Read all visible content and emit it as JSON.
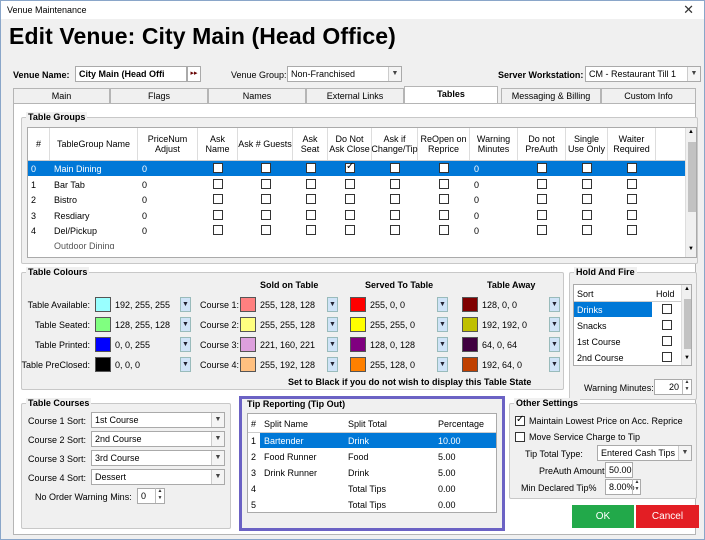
{
  "window": {
    "title": "Venue Maintenance",
    "close_glyph": "✕"
  },
  "header": {
    "title": "Edit Venue: City Main (Head Office)"
  },
  "venue_name": {
    "label": "Venue Name:",
    "value": "City Main (Head Offi",
    "picker": "▸▸"
  },
  "venue_group": {
    "label": "Venue Group:",
    "value": "Non-Franchised"
  },
  "server_workstation": {
    "label": "Server Workstation:",
    "value": "CM - Restaurant Till 1"
  },
  "tabs": [
    {
      "label": "Main"
    },
    {
      "label": "Flags"
    },
    {
      "label": "Names"
    },
    {
      "label": "External Links"
    },
    {
      "label": "Tables"
    },
    {
      "label": "Messaging & Billing"
    },
    {
      "label": "Custom Info"
    }
  ],
  "table_groups": {
    "title": "Table Groups",
    "columns": [
      "#",
      "TableGroup Name",
      "PriceNum Adjust",
      "Ask Name",
      "Ask # Guests",
      "Ask Seat",
      "Do Not Ask Close",
      "Ask if Change/Tip",
      "ReOpen on Reprice",
      "Warning Minutes",
      "Do not PreAuth",
      "Single Use Only",
      "Waiter Required"
    ],
    "rows": [
      {
        "num": "0",
        "name": "Main Dining",
        "price": "0",
        "warn": "0",
        "checks": [
          false,
          false,
          false,
          true,
          false,
          false,
          false,
          false,
          false
        ]
      },
      {
        "num": "1",
        "name": "Bar Tab",
        "price": "0",
        "warn": "0",
        "checks": [
          false,
          false,
          false,
          false,
          false,
          false,
          false,
          false,
          false
        ]
      },
      {
        "num": "2",
        "name": "Bistro",
        "price": "0",
        "warn": "0",
        "checks": [
          false,
          false,
          false,
          false,
          false,
          false,
          false,
          false,
          false
        ]
      },
      {
        "num": "3",
        "name": "Resdiary",
        "price": "0",
        "warn": "0",
        "checks": [
          false,
          false,
          false,
          false,
          false,
          false,
          false,
          false,
          false
        ]
      },
      {
        "num": "4",
        "name": "Del/Pickup",
        "price": "0",
        "warn": "0",
        "checks": [
          false,
          false,
          false,
          false,
          false,
          false,
          false,
          false,
          false
        ]
      }
    ],
    "partial_row": "Outdoor Dining"
  },
  "table_colours": {
    "title": "Table Colours",
    "states": [
      {
        "label": "Table Available:",
        "color": "#99ffff",
        "value": "192, 255, 255"
      },
      {
        "label": "Table Seated:",
        "color": "#80ff80",
        "value": "128, 255, 128"
      },
      {
        "label": "Table Printed:",
        "color": "#0000ff",
        "value": "0, 0, 255"
      },
      {
        "label": "Table PreClosed:",
        "color": "#000000",
        "value": "0, 0, 0"
      }
    ],
    "sold_title": "Sold on Table",
    "served_title": "Served To Table",
    "away_title": "Table Away",
    "courses": [
      {
        "label": "Course 1:",
        "sold": {
          "color": "#ff8080",
          "value": "255, 128, 128"
        },
        "served": {
          "color": "#ff0000",
          "value": "255, 0, 0"
        },
        "away": {
          "color": "#800000",
          "value": "128, 0, 0"
        }
      },
      {
        "label": "Course 2:",
        "sold": {
          "color": "#ffff80",
          "value": "255, 255, 128"
        },
        "served": {
          "color": "#ffff00",
          "value": "255, 255, 0"
        },
        "away": {
          "color": "#c0c000",
          "value": "192, 192, 0"
        }
      },
      {
        "label": "Course 3:",
        "sold": {
          "color": "#dda0dd",
          "value": "221, 160, 221"
        },
        "served": {
          "color": "#800080",
          "value": "128, 0, 128"
        },
        "away": {
          "color": "#400040",
          "value": "64, 0, 64"
        }
      },
      {
        "label": "Course 4:",
        "sold": {
          "color": "#ffc080",
          "value": "255, 192, 128"
        },
        "served": {
          "color": "#ff8000",
          "value": "255, 128, 0"
        },
        "away": {
          "color": "#c04000",
          "value": "192, 64, 0"
        }
      }
    ],
    "note": "Set to Black if you do not wish to display this Table State"
  },
  "hold_and_fire": {
    "title": "Hold And Fire",
    "col_sort": "Sort",
    "col_hold": "Hold",
    "items": [
      {
        "label": "Drinks",
        "selected": true
      },
      {
        "label": "Snacks"
      },
      {
        "label": "1st Course"
      },
      {
        "label": "2nd Course"
      }
    ],
    "warning_label": "Warning Minutes:",
    "warning_value": "20"
  },
  "table_courses": {
    "title": "Table Courses",
    "items": [
      {
        "label": "Course 1 Sort:",
        "value": "1st Course"
      },
      {
        "label": "Course 2 Sort:",
        "value": "2nd Course"
      },
      {
        "label": "Course 3 Sort:",
        "value": "3rd Course"
      },
      {
        "label": "Course 4 Sort:",
        "value": "Dessert"
      }
    ],
    "no_order_label": "No Order Warning Mins:",
    "no_order_value": "0"
  },
  "tip_reporting": {
    "title": "Tip Reporting (Tip Out)",
    "columns": [
      "#",
      "Split Name",
      "Split Total",
      "Percentage"
    ],
    "rows": [
      {
        "num": "1",
        "name": "Bartender",
        "total": "Drink",
        "pct": "10.00",
        "selected": true
      },
      {
        "num": "2",
        "name": "Food Runner",
        "total": "Food",
        "pct": "5.00"
      },
      {
        "num": "3",
        "name": "Drink Runner",
        "total": "Drink",
        "pct": "5.00"
      },
      {
        "num": "4",
        "name": "",
        "total": "Total Tips",
        "pct": "0.00"
      },
      {
        "num": "5",
        "name": "",
        "total": "Total Tips",
        "pct": "0.00"
      }
    ]
  },
  "other_settings": {
    "title": "Other Settings",
    "maintain_lowest": {
      "label": "Maintain Lowest Price on Acc. Reprice",
      "checked": true
    },
    "move_service": {
      "label": "Move Service Charge to Tip",
      "checked": false
    },
    "tip_total_type": {
      "label": "Tip Total Type:",
      "value": "Entered Cash Tips"
    },
    "preauth": {
      "label": "PreAuth Amount:",
      "value": "50.00"
    },
    "min_tip": {
      "label": "Min Declared Tip%",
      "value": "8.00%"
    }
  },
  "buttons": {
    "ok": "OK",
    "cancel": "Cancel",
    "ok_color": "#22a94a",
    "cancel_color": "#e31e24"
  },
  "accent": "#0078d7"
}
